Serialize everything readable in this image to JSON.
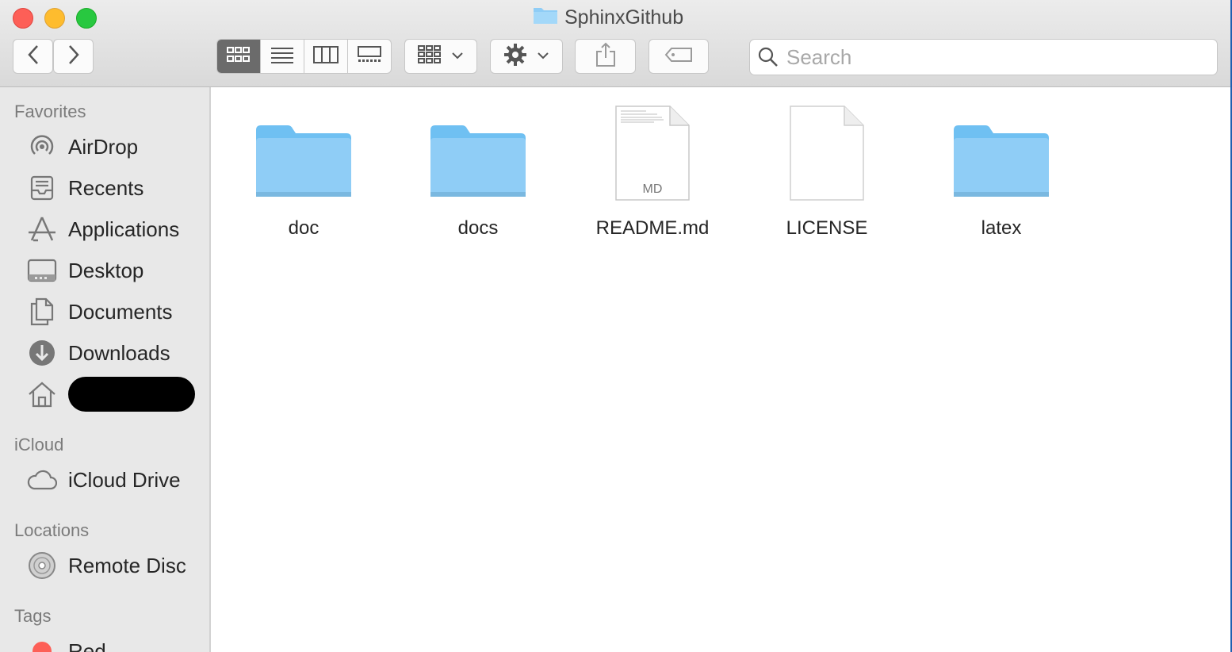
{
  "window": {
    "title": "SphinxGithub"
  },
  "toolbar": {
    "back": "back",
    "forward": "forward",
    "view_modes": [
      "icon-view",
      "list-view",
      "column-view",
      "gallery-view"
    ],
    "active_view": "icon-view",
    "search_placeholder": "Search"
  },
  "sidebar": {
    "sections": {
      "favorites": "Favorites",
      "icloud": "iCloud",
      "locations": "Locations",
      "tags": "Tags"
    },
    "favorites": [
      {
        "label": "AirDrop",
        "icon": "airdrop-icon"
      },
      {
        "label": "Recents",
        "icon": "recents-icon"
      },
      {
        "label": "Applications",
        "icon": "applications-icon"
      },
      {
        "label": "Desktop",
        "icon": "desktop-icon"
      },
      {
        "label": "Documents",
        "icon": "documents-icon"
      },
      {
        "label": "Downloads",
        "icon": "downloads-icon"
      }
    ],
    "icloud": [
      {
        "label": "iCloud Drive",
        "icon": "cloud-icon"
      }
    ],
    "locations": [
      {
        "label": "Remote Disc",
        "icon": "disc-icon"
      }
    ],
    "tags": [
      {
        "label": "Red",
        "color": "#fd5f57"
      }
    ]
  },
  "files": [
    {
      "name": "doc",
      "type": "folder"
    },
    {
      "name": "docs",
      "type": "folder"
    },
    {
      "name": "README.md",
      "type": "document",
      "badge": "MD"
    },
    {
      "name": "LICENSE",
      "type": "document"
    },
    {
      "name": "latex",
      "type": "folder"
    }
  ],
  "colors": {
    "folder": "#8fcdf6",
    "folder_dark": "#6bb7ec",
    "accent": "#1f5fb0"
  }
}
